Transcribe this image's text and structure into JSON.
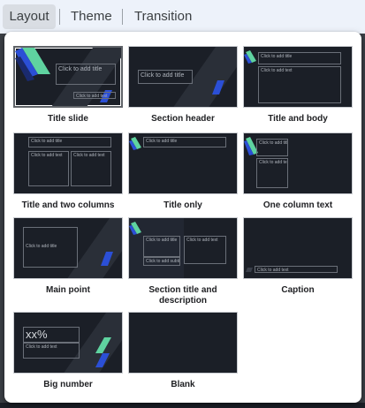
{
  "tabs": [
    {
      "label": "Layout",
      "active": true
    },
    {
      "label": "Theme",
      "active": false
    },
    {
      "label": "Transition",
      "active": false
    }
  ],
  "colors": {
    "thumb_bg": "#1b1f27",
    "accent_green": "#5fd3a0",
    "accent_blue": "#2b4fd6",
    "accent_dark_blue": "#1a2a6e"
  },
  "layouts": [
    {
      "name": "Title slide",
      "title_ph": "Click to add title",
      "sub_ph": "Click to add text",
      "selected": true
    },
    {
      "name": "Section header",
      "title_ph": "Click to add title"
    },
    {
      "name": "Title and body",
      "title_ph": "Click to add title",
      "body_ph": "Click to add text"
    },
    {
      "name": "Title and two columns",
      "title_ph": "Click to add title",
      "col1_ph": "Click to add text",
      "col2_ph": "Click to add text"
    },
    {
      "name": "Title only",
      "title_ph": "Click to add title"
    },
    {
      "name": "One column text",
      "title_ph": "Click to add title",
      "body_ph": "Click to add text"
    },
    {
      "name": "Main point",
      "title_ph": "Click to add title"
    },
    {
      "name": "Section title and description",
      "title_ph": "Click to add title",
      "sub_ph": "Click to add subtitle",
      "body_ph": "Click to add text"
    },
    {
      "name": "Caption",
      "caption_ph": "Click to add text"
    },
    {
      "name": "Big number",
      "number_ph": "xx%",
      "body_ph": "Click to add text"
    },
    {
      "name": "Blank"
    }
  ]
}
